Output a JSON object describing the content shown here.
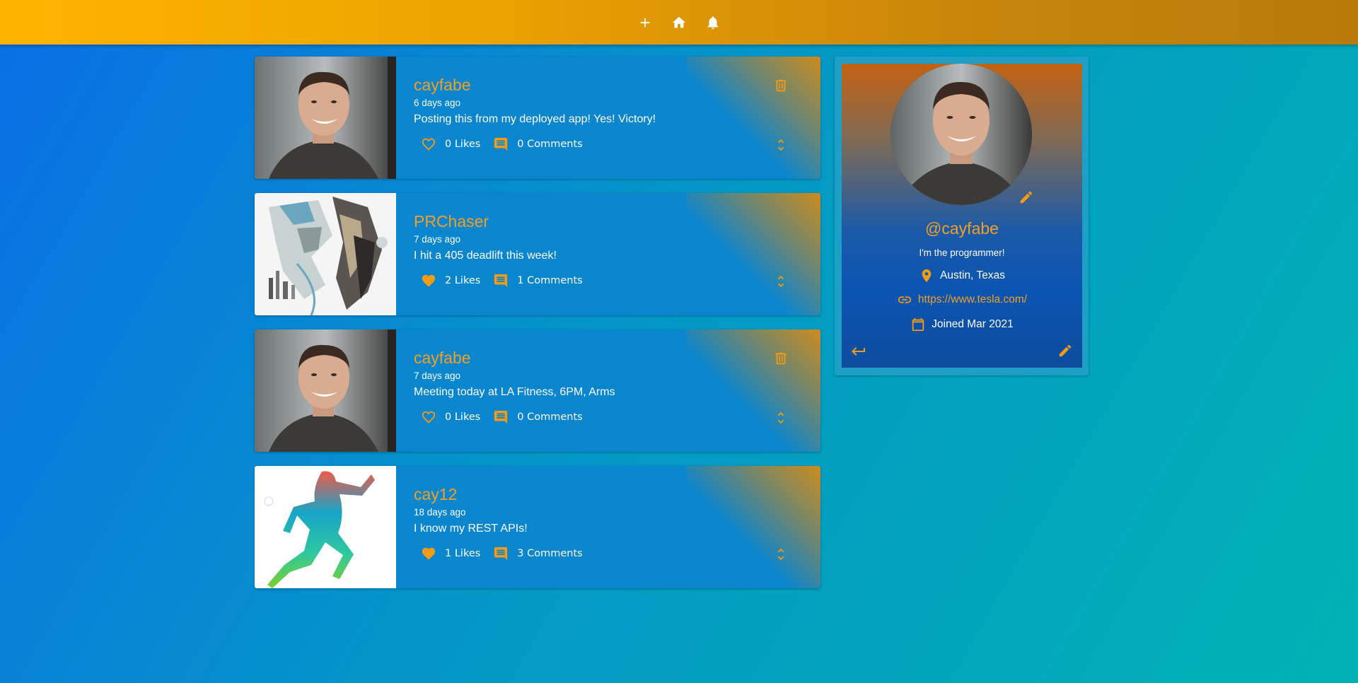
{
  "appbar": {
    "icons": [
      "add-icon",
      "home-icon",
      "bell-icon"
    ]
  },
  "posts": [
    {
      "user": "cayfabe",
      "time": "6 days ago",
      "text": "Posting this from my deployed app! Yes! Victory!",
      "likes": "0 Likes",
      "comments": "0 Comments",
      "liked": false,
      "deletable": true,
      "image": "portrait-photo"
    },
    {
      "user": "PRChaser",
      "time": "7 days ago",
      "text": "I hit a 405 deadlift this week!",
      "likes": "2 Likes",
      "comments": "1 Comments",
      "liked": true,
      "deletable": false,
      "image": "sketch-art"
    },
    {
      "user": "cayfabe",
      "time": "7 days ago",
      "text": "Meeting today at LA Fitness, 6PM, Arms",
      "likes": "0 Likes",
      "comments": "0 Comments",
      "liked": false,
      "deletable": true,
      "image": "portrait-photo"
    },
    {
      "user": "cay12",
      "time": "18 days ago",
      "text": "I know my REST APIs!",
      "likes": "1 Likes",
      "comments": "3 Comments",
      "liked": true,
      "deletable": false,
      "image": "runner-silhouette"
    }
  ],
  "profile": {
    "handle": "@cayfabe",
    "bio": "I'm the programmer!",
    "location": "Austin, Texas",
    "website": "https://www.tesla.com/",
    "joined": "Joined Mar 2021"
  },
  "colors": {
    "accent": "#f29b16",
    "appbar": "#ffb300",
    "card": "#0a86cf"
  }
}
